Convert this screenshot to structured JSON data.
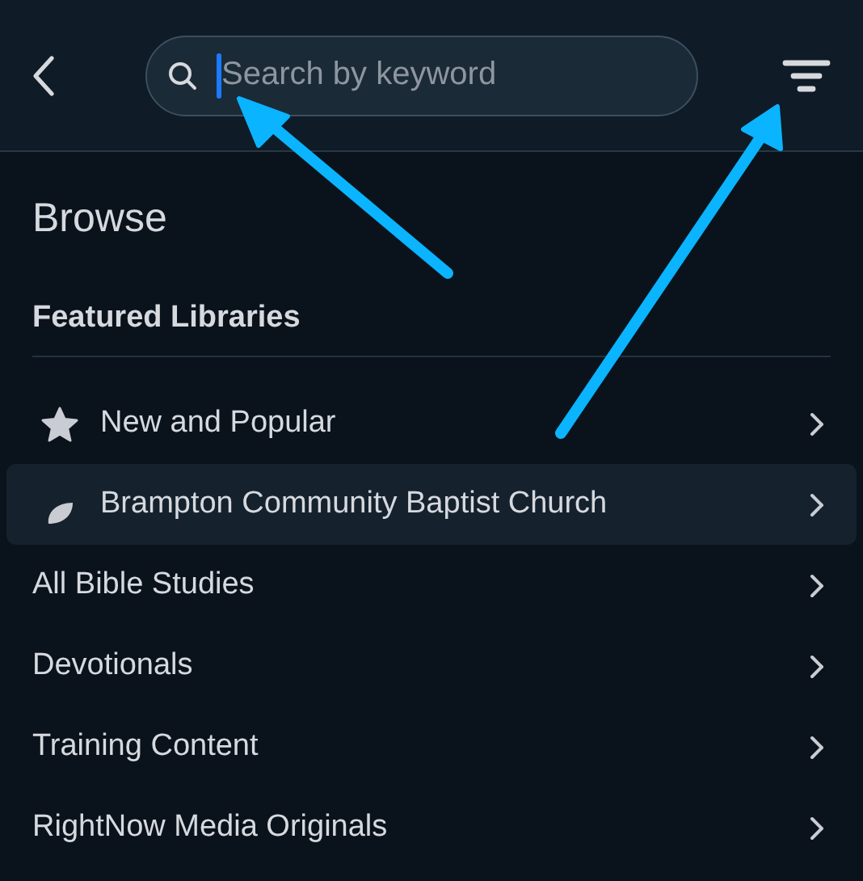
{
  "header": {
    "search": {
      "placeholder": "Search by keyword",
      "focused": true
    }
  },
  "title": "Browse",
  "featured": {
    "heading": "Featured Libraries",
    "items": [
      {
        "label": "New and Popular",
        "kind": "star",
        "selected": false
      },
      {
        "label": "Brampton Community Baptist Church",
        "kind": "leaf",
        "selected": true
      }
    ]
  },
  "categories": [
    {
      "label": "All Bible Studies",
      "selected": false
    },
    {
      "label": "Devotionals",
      "selected": false
    },
    {
      "label": "Training Content",
      "selected": false
    },
    {
      "label": "RightNow Media Originals",
      "selected": false
    }
  ]
}
